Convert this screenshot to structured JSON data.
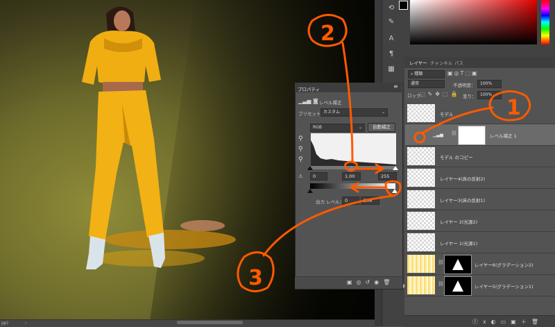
{
  "canvas": {
    "status_left": "pp)",
    "status_arrow": "›"
  },
  "layers_panel": {
    "tabs": [
      "レイヤー",
      "チャンネル",
      "パス"
    ],
    "kind_label": "種類",
    "blend_mode": "通常",
    "opacity_label": "不透明度：",
    "opacity_value": "100%",
    "fill_label": "塗り：",
    "fill_value": "100%",
    "lock_label": "ロック：",
    "layers": [
      {
        "name": "モデル",
        "thumb": "transparent",
        "visible": false,
        "selected": false
      },
      {
        "name": "レベル補正 1",
        "thumb": "adjustment",
        "visible": false,
        "selected": true
      },
      {
        "name": "モデル のコピー",
        "thumb": "transparent",
        "visible": false,
        "selected": false
      },
      {
        "name": "レイヤー4(床の反射2)",
        "thumb": "transparent",
        "visible": false,
        "selected": false
      },
      {
        "name": "レイヤー3(床の反射1)",
        "thumb": "transparent",
        "visible": false,
        "selected": false
      },
      {
        "name": "レイヤー 2(光源2)",
        "thumb": "transparent",
        "visible": false,
        "selected": false
      },
      {
        "name": "レイヤー 1(光源1)",
        "thumb": "transparent",
        "visible": false,
        "selected": false
      },
      {
        "name": "レイヤー6(グラデーション2)",
        "thumb": "gradient",
        "visible": false,
        "selected": false
      },
      {
        "name": "レイヤー5(グラデーション1)",
        "thumb": "gradient",
        "visible": true,
        "selected": false
      }
    ]
  },
  "properties": {
    "tab": "プロパティ",
    "title": "レベル補正",
    "preset_label": "プリセット：",
    "preset_value": "カスタム",
    "channel": "RGB",
    "auto_button": "自動補正",
    "input_black": "0",
    "input_gamma": "1.00",
    "input_white": "255",
    "output_label": "出力 レベル：",
    "output_black": "0",
    "output_white": "254"
  },
  "annotations": {
    "color": "#ff5a00",
    "labels": [
      "1",
      "2",
      "3"
    ]
  }
}
